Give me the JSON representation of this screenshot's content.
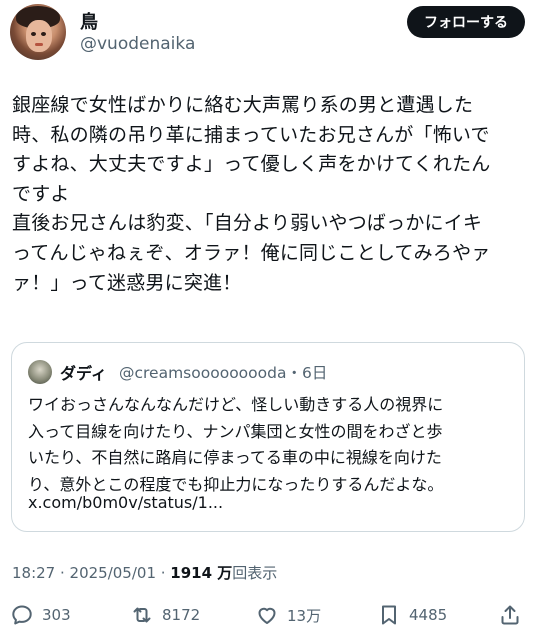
{
  "author": {
    "name": "鳥",
    "handle": "@vuodenaika",
    "follow_label": "フォローする",
    "avatar_icon": "profile-photo-icon"
  },
  "tweet": {
    "text": "銀座線で女性ばかりに絡む大声罵り系の男と遭遇した\n時、私の隣の吊り革に捕まっていたお兄さんが「怖いで\nすよね、大丈夫ですよ」って優しく声をかけてくれたん\nですよ\n直後お兄さんは豹変、「自分より弱いやつばっかにイキ\nってんじゃねぇぞ、オラァ！俺に同じことしてみろやァ\nァ！」って迷惑男に突進！"
  },
  "quote": {
    "name": "ダディ",
    "handle_time": "@creamsooooooooda・6日",
    "text": "ワイおっさんなんなんだけど、怪しい動きする人の視界に\n入って目線を向けたり、ナンパ集団と女性の間をわざと歩\nいたり、不自然に路肩に停まってる車の中に視線を向けた\nり、意外とこの程度でも抑止力になったりするんだよな。",
    "link": "x.com/b0m0v/status/1..."
  },
  "meta": {
    "datetime": "18:27 · 2025/05/01 · ",
    "views_count": "1914 万",
    "views_label": "回表示"
  },
  "actions": {
    "replies": "303",
    "reposts": "8172",
    "likes": "13万",
    "bookmarks": "4485"
  },
  "colors": {
    "text": "#0f1419",
    "secondary": "#536471",
    "border": "#cfd9de",
    "button_bg": "#0f1419"
  }
}
